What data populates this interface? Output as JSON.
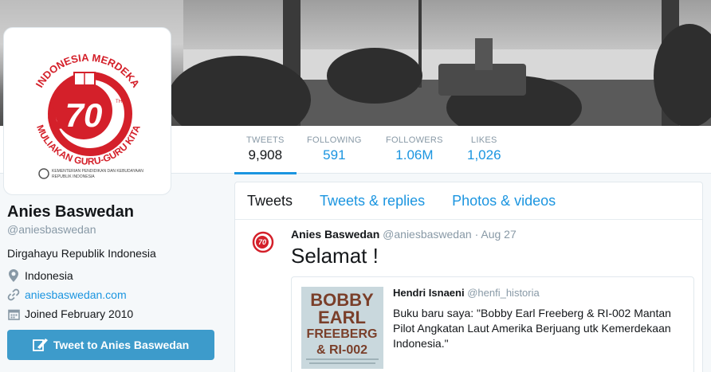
{
  "colors": {
    "accent": "#1b95e0",
    "logo_red": "#d4202a",
    "button": "#3d9bcb"
  },
  "nav": {
    "stats": [
      {
        "label": "TWEETS",
        "value": "9,908"
      },
      {
        "label": "FOLLOWING",
        "value": "591"
      },
      {
        "label": "FOLLOWERS",
        "value": "1.06M"
      },
      {
        "label": "LIKES",
        "value": "1,026"
      }
    ]
  },
  "avatar_logo": {
    "top_text": "INDONESIA MERDEKA",
    "number": "70",
    "superscript": "TH",
    "bottom_text": "MULIAKAN GURU-GURU KITA",
    "org_line1": "KEMENTERIAN PENDIDIKAN DAN KEBUDAYAAN",
    "org_line2": "REPUBLIK INDONESIA"
  },
  "profile": {
    "name": "Anies Baswedan",
    "handle": "@aniesbaswedan",
    "bio": "Dirgahayu Republik Indonesia",
    "location": "Indonesia",
    "website": "aniesbaswedan.com",
    "joined": "Joined February 2010",
    "tweet_to_label": "Tweet to Anies Baswedan"
  },
  "timeline": {
    "tabs": [
      "Tweets",
      "Tweets & replies",
      "Photos & videos"
    ],
    "tweet": {
      "name": "Anies Baswedan",
      "handle": "@aniesbaswedan",
      "sep": "·",
      "time": "Aug 27",
      "text": "Selamat !"
    },
    "quote": {
      "name": "Hendri Isnaeni",
      "handle": "@henfi_historia",
      "text": "Buku baru saya: \"Bobby Earl Freeberg & RI-002 Mantan Pilot Angkatan Laut Amerika Berjuang utk Kemerdekaan Indonesia.\"",
      "book_title_1": "BOBBY",
      "book_title_2": "EARL",
      "book_title_3": "FREEBERG",
      "book_title_4": "& RI-002"
    }
  },
  "icons": {
    "location": "map-pin-icon",
    "website": "link-icon",
    "joined": "calendar-icon",
    "tweet_button": "quill-icon"
  }
}
